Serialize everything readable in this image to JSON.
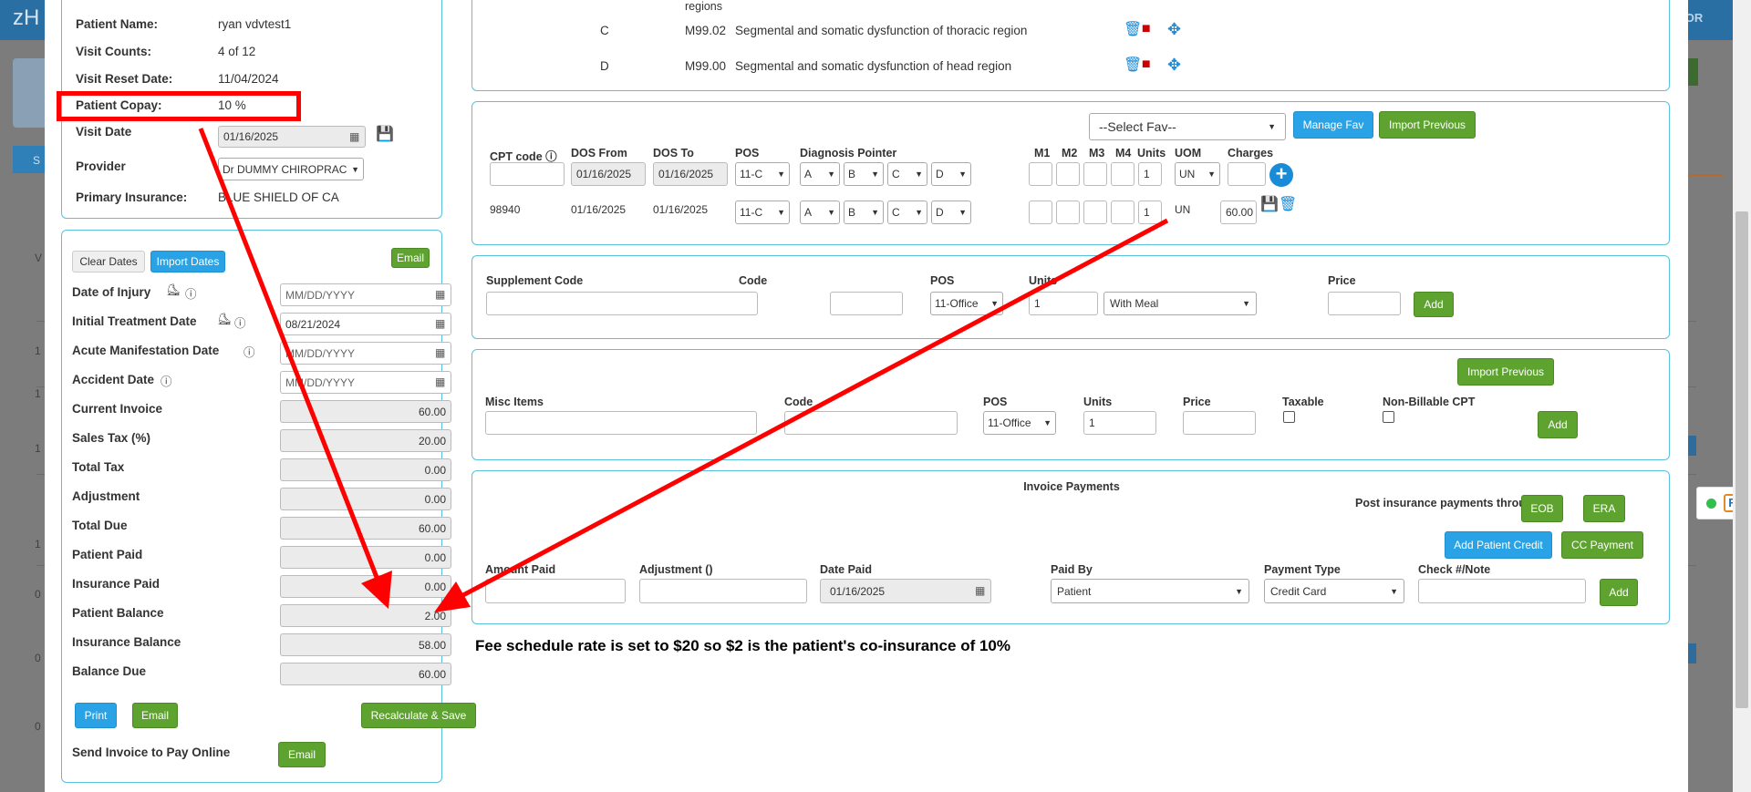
{
  "background": {
    "logo_text": "zH",
    "top_right_text": "TOR",
    "tab_text": "S",
    "row_numbers": [
      "V",
      "1",
      "1",
      "1",
      "1",
      "0",
      "0",
      "0"
    ]
  },
  "patient_info": {
    "name_label": "Patient Name:",
    "name_value": "ryan vdvtest1",
    "visit_counts_label": "Visit Counts:",
    "visit_counts_value": "4 of 12",
    "visit_reset_label": "Visit Reset Date:",
    "visit_reset_value": "11/04/2024",
    "copay_label": "Patient Copay:",
    "copay_value": "10 %",
    "visit_date_label": "Visit Date",
    "visit_date_value": "01/16/2025",
    "provider_label": "Provider",
    "provider_value": "Dr DUMMY CHIROPRAC",
    "primary_ins_label": "Primary Insurance:",
    "primary_ins_value": "BLUE SHIELD OF CA"
  },
  "invoice_panel": {
    "clear_dates": "Clear Dates",
    "import_dates": "Import Dates",
    "email_top": "Email",
    "dates": [
      {
        "label": "Date of Injury",
        "value": "",
        "placeholder": "MM/DD/YYYY"
      },
      {
        "label": "Initial Treatment Date",
        "value": "08/21/2024",
        "placeholder": "MM/DD/YYYY"
      },
      {
        "label": "Acute Manifestation Date",
        "value": "",
        "placeholder": "MM/DD/YYYY"
      },
      {
        "label": "Accident Date",
        "value": "",
        "placeholder": "MM/DD/YYYY"
      }
    ],
    "totals": [
      {
        "label": "Current Invoice",
        "value": "60.00"
      },
      {
        "label": "Sales Tax (%)",
        "value": "20.00"
      },
      {
        "label": "Total Tax",
        "value": "0.00"
      },
      {
        "label": "Adjustment",
        "value": "0.00"
      },
      {
        "label": "Total Due",
        "value": "60.00"
      },
      {
        "label": "Patient Paid",
        "value": "0.00"
      },
      {
        "label": "Insurance Paid",
        "value": "0.00"
      },
      {
        "label": "Patient Balance",
        "value": "2.00"
      },
      {
        "label": "Insurance Balance",
        "value": "58.00"
      },
      {
        "label": "Balance Due",
        "value": "60.00"
      }
    ],
    "print": "Print",
    "email": "Email",
    "recalc": "Recalculate & Save",
    "send_label": "Send Invoice to Pay Online",
    "send_email": "Email"
  },
  "diagnosis": {
    "partial_text": "regions",
    "rows": [
      {
        "letter": "C",
        "code": "M99.02",
        "desc": "Segmental and somatic dysfunction of thoracic region"
      },
      {
        "letter": "D",
        "code": "M99.00",
        "desc": "Segmental and somatic dysfunction of head region"
      }
    ]
  },
  "cpt_panel": {
    "select_fav": "--Select Fav--",
    "manage_fav": "Manage Fav",
    "import_previous": "Import Previous",
    "headers": [
      "CPT code",
      "DOS From",
      "DOS To",
      "POS",
      "Diagnosis Pointer",
      "M1",
      "M2",
      "M3",
      "M4",
      "Units",
      "UOM",
      "Charges"
    ],
    "entry": {
      "dos_from": "01/16/2025",
      "dos_to": "01/16/2025",
      "pos": "11-C",
      "ptr": [
        "A",
        "B",
        "C",
        "D"
      ],
      "units": "1",
      "uom": "UN"
    },
    "row": {
      "code": "98940",
      "dos_from": "01/16/2025",
      "dos_to": "01/16/2025",
      "pos": "11-C",
      "ptr": [
        "A",
        "B",
        "C",
        "D"
      ],
      "units": "1",
      "uom": "UN",
      "charges": "60.00"
    }
  },
  "supplement_panel": {
    "code_label": "Supplement Code",
    "code2_label": "Code",
    "pos_label": "POS",
    "pos_value": "11-Office",
    "units_label": "Units",
    "units_value": "1",
    "meal_value": "With Meal",
    "price_label": "Price",
    "add": "Add"
  },
  "misc_panel": {
    "import_previous": "Import Previous",
    "items_label": "Misc Items",
    "code_label": "Code",
    "pos_label": "POS",
    "pos_value": "11-Office",
    "units_label": "Units",
    "units_value": "1",
    "price_label": "Price",
    "taxable_label": "Taxable",
    "nonbill_label": "Non-Billable CPT",
    "add": "Add"
  },
  "payments_panel": {
    "title": "Invoice Payments",
    "post_label": "Post insurance payments through",
    "eob": "EOB",
    "era": "ERA",
    "add_credit": "Add Patient Credit",
    "cc_payment": "CC Payment",
    "amount_label": "Amount Paid",
    "adjustment_label": "Adjustment ()",
    "date_label": "Date Paid",
    "date_value": "01/16/2025",
    "paid_by_label": "Paid By",
    "paid_by_value": "Patient",
    "type_label": "Payment Type",
    "type_value": "Credit Card",
    "check_label": "Check #/Note",
    "add": "Add"
  },
  "annotation": {
    "note": "Fee schedule rate is set to $20 so $2 is the patient's co-insurance of 10%",
    "color": "#ff0000"
  }
}
